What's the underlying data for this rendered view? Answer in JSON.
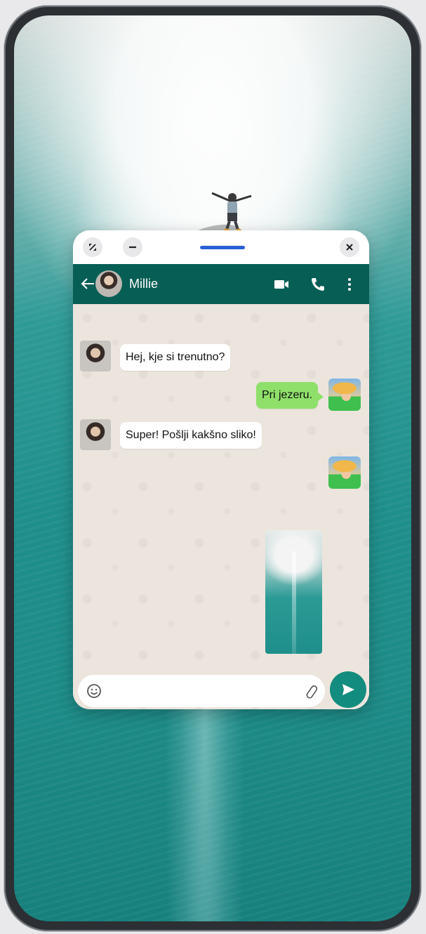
{
  "window_controls": {
    "icons": [
      "fullscreen-icon",
      "minimize-icon",
      "drag-handle",
      "close-icon"
    ]
  },
  "chat_header": {
    "contact_name": "Millie",
    "icons": [
      "back-arrow-icon",
      "video-call-icon",
      "phone-call-icon",
      "more-options-icon"
    ],
    "color": "#075e54"
  },
  "messages": [
    {
      "direction": "incoming",
      "text": "Hej, kje si trenutno?"
    },
    {
      "direction": "outgoing",
      "text": "Pri jezeru."
    },
    {
      "direction": "incoming",
      "text": "Super! Pošlji kakšno sliko!"
    },
    {
      "direction": "outgoing",
      "type": "image"
    }
  ],
  "composer": {
    "icons": [
      "emoji-icon",
      "attach-icon",
      "send-icon"
    ],
    "send_color": "#128c7e"
  },
  "colors": {
    "outgoing_bubble": "#8ee06a",
    "incoming_bubble": "#ffffff",
    "chat_background": "#ece5dd"
  }
}
